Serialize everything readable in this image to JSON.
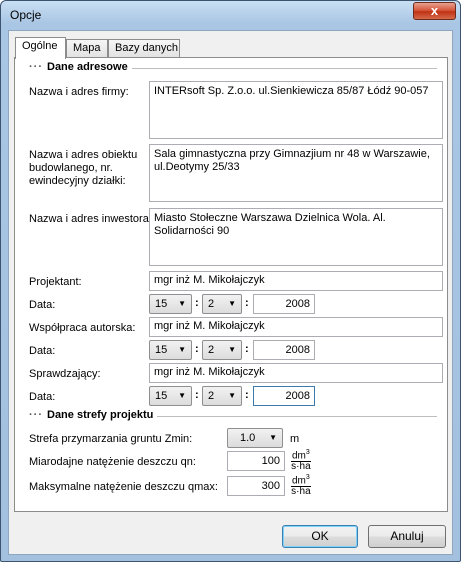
{
  "window": {
    "title": "Opcje",
    "close_glyph": "x"
  },
  "tabs": [
    {
      "label": "Ogólne",
      "active": true
    },
    {
      "label": "Mapa",
      "active": false
    },
    {
      "label": "Bazy danych",
      "active": false
    }
  ],
  "address_section": {
    "dots": "···",
    "title": "Dane adresowe",
    "company_label": "Nazwa i adres firmy:",
    "company_value": "INTERsoft Sp. Z.o.o. ul.Sienkiewicza 85/87 Łódź 90-057",
    "object_label": "Nazwa i adres obiektu budowlanego, nr. ewindecyjny działki:",
    "object_value": "Sala gimnastyczna przy Gimnazjium nr 48 w Warszawie, ul.Deotymy 25/33",
    "investor_label": "Nazwa i adres inwestora:",
    "investor_value": "Miasto Stołeczne Warszawa Dzielnica Wola. Al. Solidarności 90",
    "designer_label": "Projektant:",
    "designer_value": "mgr inż M. Mikołajczyk",
    "coauthor_label": "Współpraca autorska:",
    "coauthor_value": "mgr inż M. Mikołajczyk",
    "checker_label": "Sprawdzający:",
    "checker_value": "mgr inż M. Mikołajczyk",
    "date_label": "Data:",
    "date_sep": ":",
    "designer_date": {
      "day": "15",
      "month": "2",
      "year": "2008"
    },
    "coauthor_date": {
      "day": "15",
      "month": "2",
      "year": "2008"
    },
    "checker_date": {
      "day": "15",
      "month": "2",
      "year": "2008"
    }
  },
  "project_section": {
    "dots": "···",
    "title": "Dane strefy projektu",
    "frost_label": "Strefa przymarzania gruntu Zmin:",
    "frost_value": "1.0",
    "frost_unit": "m",
    "rain_label": "Miarodajne natężenie deszczu qn:",
    "rain_value": "100",
    "max_rain_label": "Maksymalne natężenie deszczu qmax:",
    "max_rain_value": "300",
    "flow_unit_top": "dm",
    "flow_unit_exp": "3",
    "flow_unit_bottom": "s·ha"
  },
  "buttons": {
    "ok": "OK",
    "cancel": "Anuluj"
  },
  "icons": {
    "dropdown": "chevron-down-icon",
    "close": "close-icon"
  }
}
